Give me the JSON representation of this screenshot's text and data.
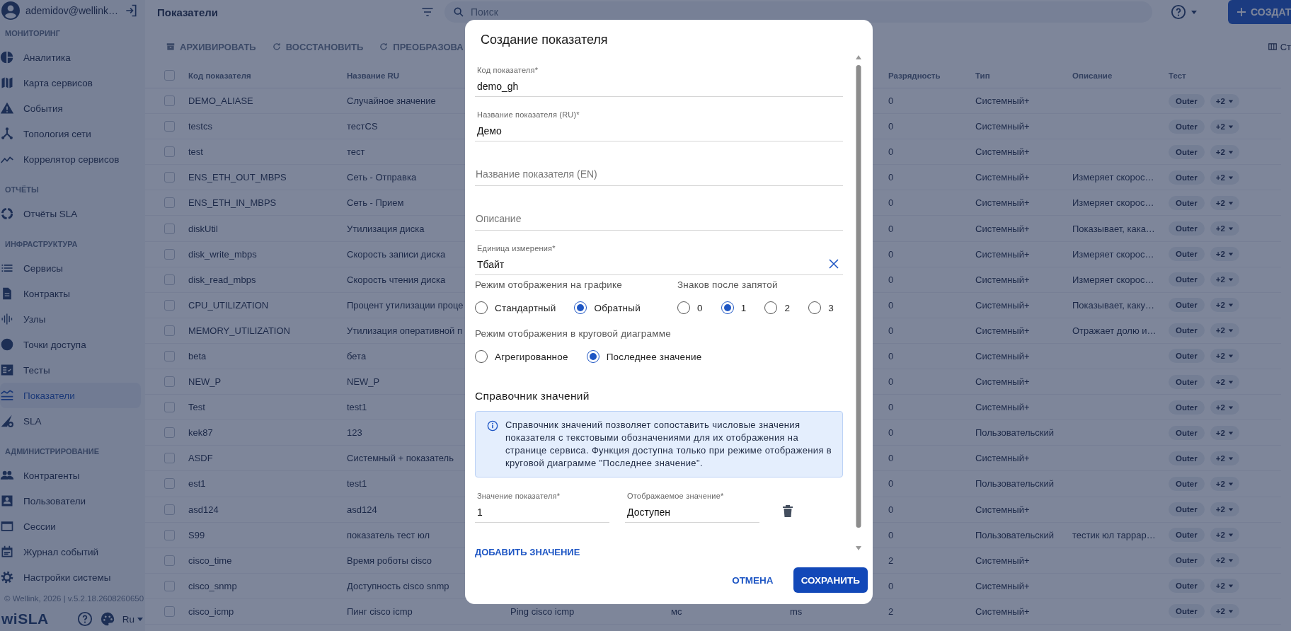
{
  "sidebar": {
    "user": "ademidov@wellink…",
    "sections": [
      {
        "title": "МОНИТОРИНГ",
        "items": [
          {
            "label": "Аналитика",
            "selected": false
          },
          {
            "label": "Карта сервисов",
            "selected": false
          },
          {
            "label": "События",
            "selected": false
          },
          {
            "label": "Топология сети",
            "selected": false
          },
          {
            "label": "Коррелятор сервисов",
            "selected": false
          }
        ]
      },
      {
        "title": "ОТЧЁТЫ",
        "items": [
          {
            "label": "Отчёты SLA",
            "selected": false
          }
        ]
      },
      {
        "title": "ИНФРАСТРУКТУРА",
        "items": [
          {
            "label": "Сервисы",
            "selected": false
          },
          {
            "label": "Контракты",
            "selected": false
          },
          {
            "label": "Узлы",
            "selected": false
          },
          {
            "label": "Точки доступа",
            "selected": false
          },
          {
            "label": "Тесты",
            "selected": false
          },
          {
            "label": "Показатели",
            "selected": true
          },
          {
            "label": "SLA",
            "selected": false
          }
        ]
      },
      {
        "title": "АДМИНИСТРИРОВАНИЕ",
        "items": [
          {
            "label": "Контрагенты",
            "selected": false
          },
          {
            "label": "Пользователи",
            "selected": false
          },
          {
            "label": "Сессии",
            "selected": false
          },
          {
            "label": "Журнал событий",
            "selected": false
          },
          {
            "label": "Настройки системы",
            "selected": false
          }
        ]
      }
    ],
    "footer": "© Wellink, 2026 | v.5.2.18.2608260650",
    "logo": "wiSLA",
    "language": "Ru"
  },
  "header": {
    "title": "Показатели",
    "search": {
      "placeholder": "Поиск"
    },
    "create_button": "СОЗДАТ"
  },
  "toolbar": {
    "buttons": [
      "АРХИВИРОВАТЬ",
      "ВОССТАНОВИТЬ",
      "ПРЕОБРАЗОВА"
    ],
    "columns_button": "Ст"
  },
  "table": {
    "select_all": {
      "checked": false
    },
    "columns": [
      "Код показателя",
      "Название RU",
      "Разрядность",
      "Тип",
      "Описание",
      "Тест"
    ],
    "rows": [
      {
        "checked": false,
        "code": "DEMO_ALIASE",
        "name_ru": "Случайное значение",
        "digits": "0",
        "type": "Системный+",
        "test": "Outer",
        "more": "+2"
      },
      {
        "checked": false,
        "code": "testcs",
        "name_ru": "тестCS",
        "digits": "0",
        "type": "Системный+",
        "test": "Outer",
        "more": "+2"
      },
      {
        "checked": false,
        "code": "test",
        "name_ru": "тест",
        "digits": "0",
        "type": "Системный+",
        "test": "Outer",
        "more": "+2"
      },
      {
        "checked": false,
        "code": "ENS_ETH_OUT_MBPS",
        "name_ru": "Сеть - Отправка",
        "digits": "0",
        "type": "Системный+",
        "description": "Измеряет скорос…",
        "test": "Outer",
        "more": "+2"
      },
      {
        "checked": false,
        "code": "ENS_ETH_IN_MBPS",
        "name_ru": "Сеть - Прием",
        "digits": "0",
        "type": "Системный+",
        "description": "Измеряет скорос…",
        "test": "Outer",
        "more": "+2"
      },
      {
        "checked": false,
        "code": "diskUtil",
        "name_ru": "Утилизация диска",
        "digits": "0",
        "type": "Системный+",
        "description": "Показывает, кака…",
        "test": "Outer",
        "more": "+2"
      },
      {
        "checked": false,
        "code": "disk_write_mbps",
        "name_ru": "Скорость записи диска",
        "digits": "0",
        "type": "Системный+",
        "description": "Измеряет скорос…",
        "test": "Outer",
        "more": "+2"
      },
      {
        "checked": false,
        "code": "disk_read_mbps",
        "name_ru": "Скорость чтения диска",
        "digits": "0",
        "type": "Системный+",
        "description": "Измеряет скорос…",
        "test": "Outer",
        "more": "+2"
      },
      {
        "checked": false,
        "code": "CPU_UTILIZATION",
        "name_ru": "Процент утилизации проце",
        "digits": "0",
        "type": "Системный+",
        "description": "Показывает, каку…",
        "test": "Outer",
        "more": "+2"
      },
      {
        "checked": false,
        "code": "MEMORY_UTILIZATION",
        "name_ru": "Утилизация оперативной п",
        "digits": "0",
        "type": "Системный+",
        "description": "Отражает долю и…",
        "test": "Outer",
        "more": "+2"
      },
      {
        "checked": false,
        "code": "beta",
        "name_ru": "бета",
        "digits": "0",
        "type": "Системный+",
        "test": "Outer",
        "more": "+2"
      },
      {
        "checked": false,
        "code": "NEW_P",
        "name_ru": "NEW_P",
        "digits": "0",
        "type": "Системный+",
        "test": "Outer",
        "more": "+2"
      },
      {
        "checked": false,
        "code": "Test",
        "name_ru": "test1",
        "digits": "0",
        "type": "Системный+",
        "test": "Outer",
        "more": "+2"
      },
      {
        "checked": false,
        "code": "kek87",
        "name_ru": "123",
        "digits": "0",
        "type": "Пользовательский",
        "test": "Outer",
        "more": "+2"
      },
      {
        "checked": false,
        "code": "ASDF",
        "name_ru": "Системный + показатель",
        "digits": "0",
        "type": "Системный+",
        "test": "Outer",
        "more": "+2"
      },
      {
        "checked": false,
        "code": "est1",
        "name_ru": "test1",
        "digits": "0",
        "type": "Пользовательский",
        "test": "Outer",
        "more": "+2"
      },
      {
        "checked": false,
        "code": "asd124",
        "name_ru": "asd124",
        "digits": "0",
        "type": "Системный+",
        "test": "Outer",
        "more": "+2"
      },
      {
        "checked": false,
        "code": "S99",
        "name_ru": "показатель тест юл",
        "digits": "0",
        "type": "Пользовательский",
        "description": "тестик юл таррар…",
        "test": "Outer",
        "more": "+2"
      },
      {
        "checked": false,
        "code": "cisco_time",
        "name_ru": "Время роботы cisco",
        "digits": "2",
        "type": "Системный+",
        "test": "Outer",
        "more": "+2"
      },
      {
        "checked": false,
        "code": "cisco_snmp",
        "name_ru": "Доступность cisco snmp",
        "digits": "0",
        "type": "Системный+",
        "test": "Outer",
        "more": "+2"
      },
      {
        "checked": false,
        "code": "cisco_icmp",
        "name_ru": "Пинг cisco icmp",
        "column_3": "Ping cisco icmp",
        "column_4": "мс",
        "column_5": "ms",
        "digits": "2",
        "type": "Системный+",
        "test": "Outer",
        "more": "+2"
      }
    ]
  },
  "dialog": {
    "title": "Создание показателя",
    "fields": [
      {
        "label": "Код показателя*",
        "value": "demo_gh"
      },
      {
        "label": "Название показателя (RU)*",
        "value": "Демо"
      },
      {
        "placeholder": "Название показателя (EN)"
      },
      {
        "placeholder": "Описание"
      },
      {
        "label": "Единица измерения*",
        "value": "Тбайт",
        "clearable": true
      }
    ],
    "chart_mode": {
      "label": "Режим отображения на графике",
      "options": [
        {
          "label": "Стандартный",
          "selected": false
        },
        {
          "label": "Обратный",
          "selected": true
        }
      ]
    },
    "decimals": {
      "label": "Знаков после запятой",
      "options": [
        {
          "label": "0",
          "selected": false
        },
        {
          "label": "1",
          "selected": true
        },
        {
          "label": "2",
          "selected": false
        },
        {
          "label": "3",
          "selected": false
        }
      ]
    },
    "pie_mode": {
      "label": "Режим отображения в круговой диаграмме",
      "options": [
        {
          "label": "Агрегированное",
          "selected": false
        },
        {
          "label": "Последнее значение",
          "selected": true
        }
      ]
    },
    "dictionary": {
      "title": "Справочник значений",
      "info": "Справочник значений позволяет сопоставить числовые значения показателя с текстовыми обозначениями для их отображения на странице сервиса. Функция доступна только при режиме отображения в круговой диаграмме \"Последнее значение\".",
      "entries": [
        {
          "value_label": "Значение показателя*",
          "value": "1",
          "display_label": "Отображаемое значение*",
          "display": "Доступен"
        }
      ],
      "add_button": "ДОБАВИТЬ ЗНАЧЕНИЕ"
    },
    "buttons": {
      "cancel": "ОТМЕНА",
      "save": "СОХРАНИТЬ"
    }
  }
}
